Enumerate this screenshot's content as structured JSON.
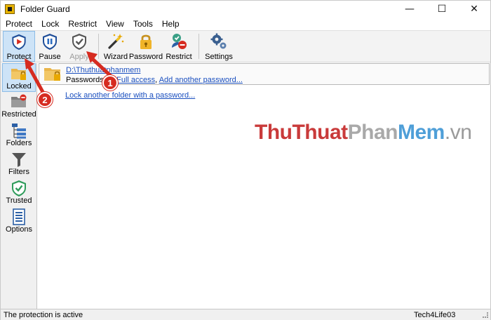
{
  "window": {
    "title": "Folder Guard",
    "controls": [
      "—",
      "☐",
      "✕"
    ]
  },
  "menu": [
    "Protect",
    "Lock",
    "Restrict",
    "View",
    "Tools",
    "Help"
  ],
  "toolbar": {
    "protect": "Protect",
    "pause": "Pause",
    "apply": "Apply",
    "wizard": "Wizard",
    "password": "Password",
    "restrict": "Restrict",
    "settings": "Settings"
  },
  "sidebar": [
    "Locked",
    "Restricted",
    "Folders",
    "Filters",
    "Trusted",
    "Options"
  ],
  "content": {
    "folder_path": "D:\\Thuthuatphanmem",
    "passwords_label": "Passwords:",
    "password_entry": "1, Full access",
    "add_password_link": "Add another password...",
    "lock_another_link": "Lock another folder with a password..."
  },
  "watermark": {
    "part1": "ThuThuat",
    "part2": "Phan",
    "part3": "Mem",
    "part4": ".vn"
  },
  "annotations": {
    "badge1": "1",
    "badge2": "2"
  },
  "status": {
    "left": "The protection is active",
    "right": "Tech4Life03"
  },
  "colors": {
    "accent_blue": "#1a4fbf",
    "selection": "#cde3f7",
    "annotation_red": "#d62b20"
  }
}
